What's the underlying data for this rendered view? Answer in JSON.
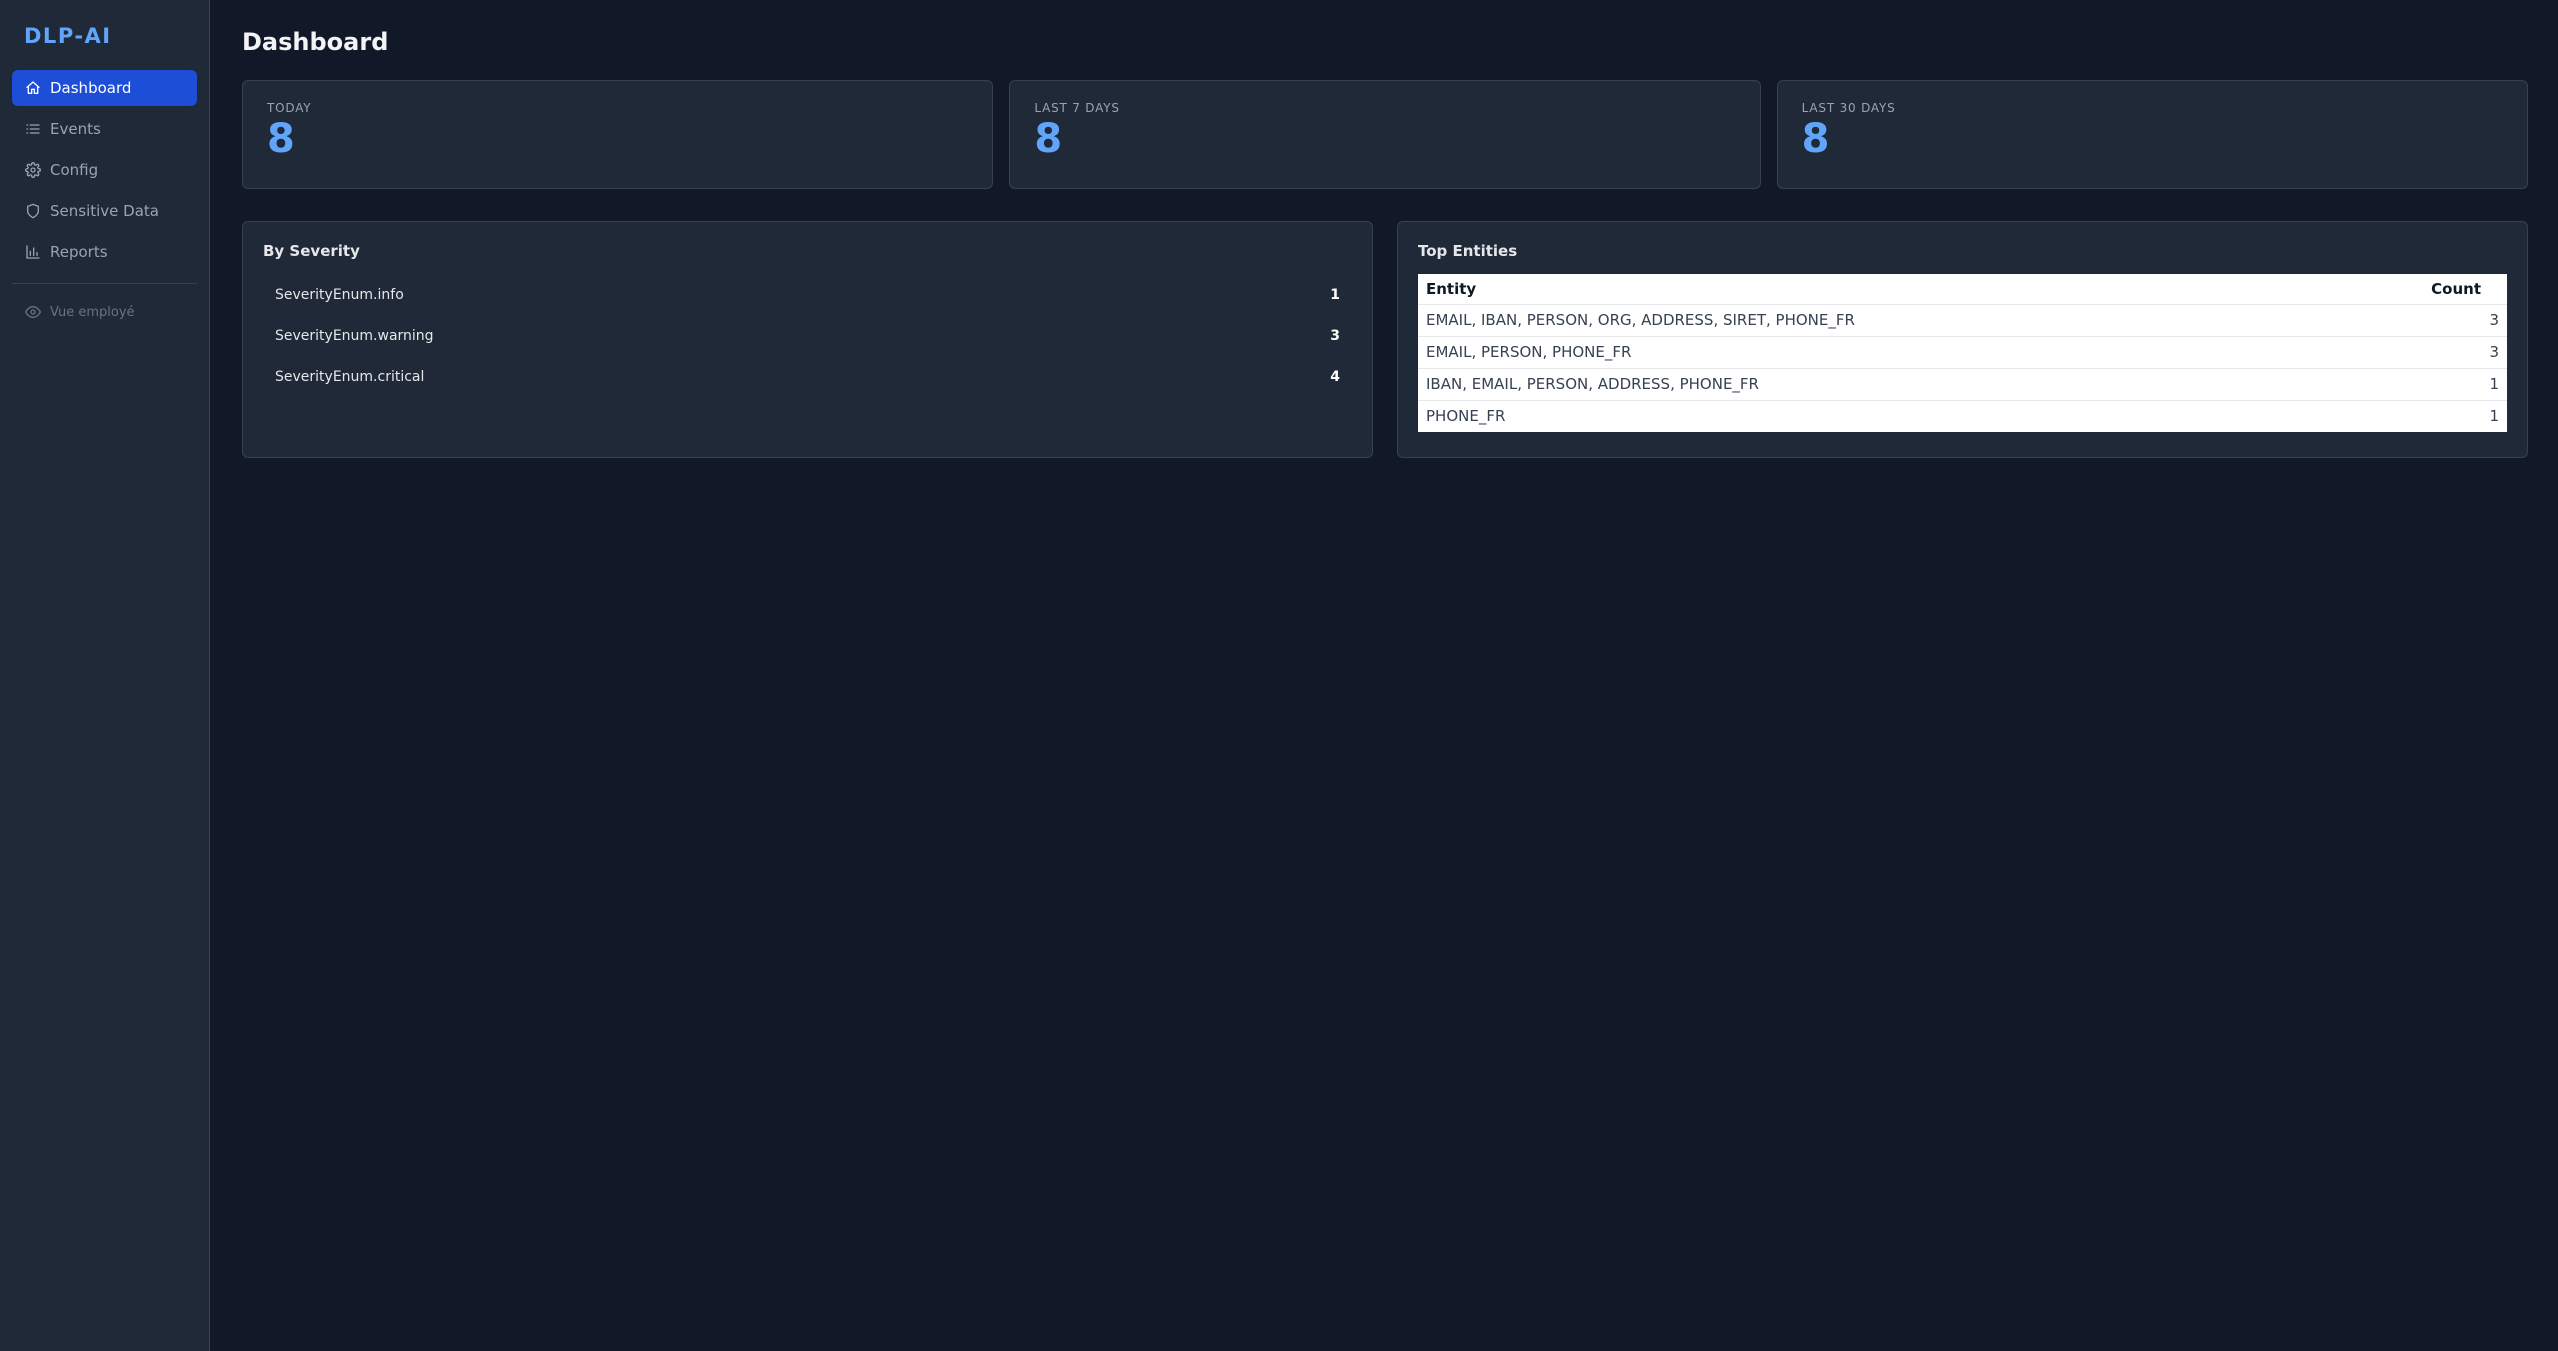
{
  "brand": "DLP-AI",
  "nav": {
    "items": [
      {
        "label": "Dashboard",
        "icon": "home-icon",
        "active": true
      },
      {
        "label": "Events",
        "icon": "list-icon"
      },
      {
        "label": "Config",
        "icon": "gear-icon"
      },
      {
        "label": "Sensitive Data",
        "icon": "shield-icon"
      },
      {
        "label": "Reports",
        "icon": "bar-chart-icon"
      }
    ],
    "employee_view": {
      "label": "Vue employé",
      "icon": "eye-icon"
    }
  },
  "page": {
    "title": "Dashboard"
  },
  "stats": [
    {
      "label": "TODAY",
      "value": "8"
    },
    {
      "label": "LAST 7 DAYS",
      "value": "8"
    },
    {
      "label": "LAST 30 DAYS",
      "value": "8"
    }
  ],
  "severity": {
    "title": "By Severity",
    "rows": [
      {
        "label": "SeverityEnum.info",
        "count": "1"
      },
      {
        "label": "SeverityEnum.warning",
        "count": "3"
      },
      {
        "label": "SeverityEnum.critical",
        "count": "4"
      }
    ]
  },
  "entities": {
    "title": "Top Entities",
    "headers": {
      "entity": "Entity",
      "count": "Count"
    },
    "rows": [
      {
        "entity": "EMAIL, IBAN, PERSON, ORG, ADDRESS, SIRET, PHONE_FR",
        "count": "3"
      },
      {
        "entity": "EMAIL, PERSON, PHONE_FR",
        "count": "3"
      },
      {
        "entity": "IBAN, EMAIL, PERSON, ADDRESS, PHONE_FR",
        "count": "1"
      },
      {
        "entity": "PHONE_FR",
        "count": "1"
      }
    ]
  },
  "colors": {
    "background": "#111827",
    "sidebar": "#1f2937",
    "accent": "#60a5fa",
    "active_nav": "#1d4ed8"
  }
}
